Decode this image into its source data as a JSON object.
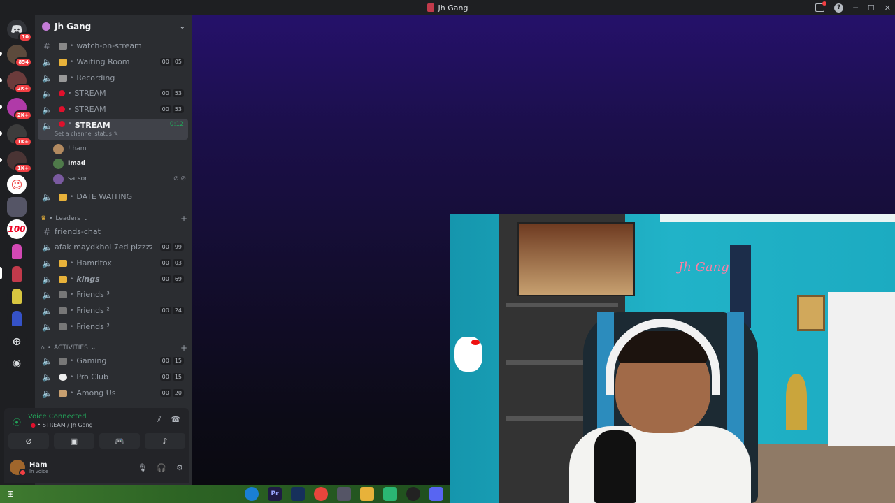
{
  "window": {
    "title": "Jh Gang"
  },
  "servers": [
    {
      "badge": "10"
    },
    {
      "badge": "854"
    },
    {
      "badge": "2K+"
    },
    {
      "badge": "2K+"
    },
    {
      "badge": "1K+"
    },
    {
      "badge": "1K+"
    },
    {
      "label": "100"
    }
  ],
  "guild": {
    "name": "Jh Gang"
  },
  "channels": [
    {
      "name": "watch-on-stream",
      "type": "text"
    },
    {
      "name": "Waiting Room",
      "a": "00",
      "b": "05"
    },
    {
      "name": "Recording"
    },
    {
      "name": "STREAM",
      "a": "00",
      "b": "53"
    },
    {
      "name": "STREAM",
      "a": "00",
      "b": "53"
    },
    {
      "name": "STREAM",
      "timer": "0:12",
      "status": "Set a channel status"
    },
    {
      "name": "DATE WAITING"
    }
  ],
  "members": [
    {
      "name": "! ham"
    },
    {
      "name": "Imad"
    },
    {
      "name": "sarsor"
    }
  ],
  "categories": {
    "leaders": "Leaders",
    "activities": "ACTIVITIES"
  },
  "leaders_channels": [
    {
      "name": "friends-chat",
      "type": "text"
    },
    {
      "name": "afak maydkhol 7ed plzzzzzzz...",
      "a": "00",
      "b": "99"
    },
    {
      "name": "Hamritox",
      "a": "00",
      "b": "03"
    },
    {
      "name": "kings",
      "a": "00",
      "b": "69"
    },
    {
      "name": "Friends ³"
    },
    {
      "name": "Friends ²",
      "a": "00",
      "b": "24"
    },
    {
      "name": "Friends ³"
    }
  ],
  "activities_channels": [
    {
      "name": "Gaming",
      "a": "00",
      "b": "15"
    },
    {
      "name": "Pro Club",
      "a": "00",
      "b": "15"
    },
    {
      "name": "Among Us",
      "a": "00",
      "b": "20"
    }
  ],
  "voice": {
    "status": "Voice Connected",
    "location": "STREAM / Jh Gang"
  },
  "user": {
    "name": "Ham",
    "status": "In voice"
  },
  "cam": {
    "neon": "Jh Gang"
  },
  "taskbar": {
    "apps": [
      "Edge",
      "Pr",
      "Steam",
      "Chrome",
      "App",
      "Files",
      "Android",
      "OBS",
      "Discord"
    ]
  },
  "colors": {
    "accent_green": "#23a55a",
    "stream_red": "#e0102c",
    "badge_red": "#f23f43",
    "sidebar_bg": "#2b2d31"
  }
}
